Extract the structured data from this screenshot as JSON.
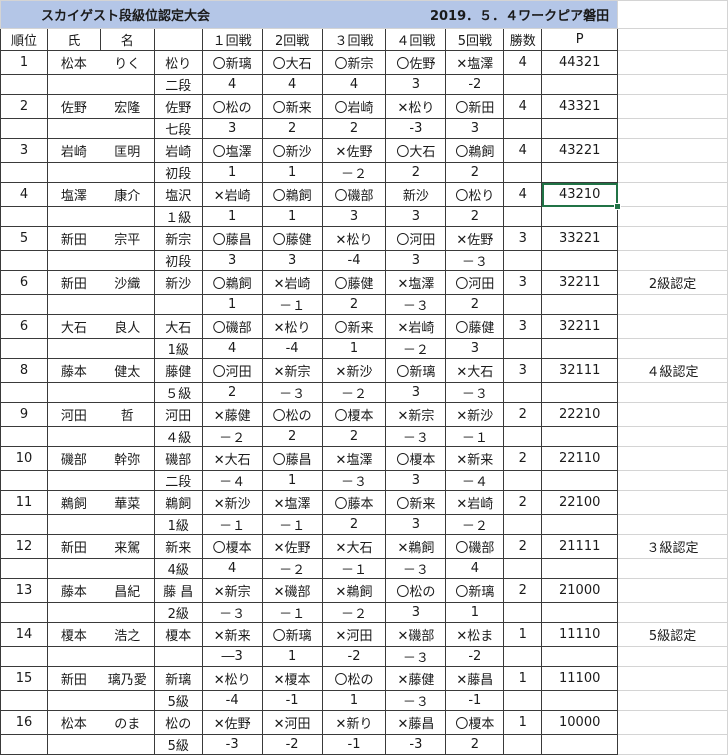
{
  "title": {
    "event": "スカイゲスト段級位認定大会",
    "date_venue": "2019．５．４ワークピア磐田"
  },
  "headers": [
    "順位",
    "氏",
    "名",
    "",
    "１回戦",
    "2回戦",
    "３回戦",
    "４回戦",
    "5回戦",
    "勝数",
    "P"
  ],
  "players": [
    {
      "rank": "1",
      "sur": "松本",
      "given": "りく",
      "short": "松り",
      "grade": "二段",
      "results": [
        "〇新璃",
        "〇大石",
        "〇新宗",
        "〇佐野",
        "✕塩澤"
      ],
      "diffs": [
        "4",
        "4",
        "4",
        "3",
        "-2"
      ],
      "wins": "4",
      "points": "44321",
      "note": ""
    },
    {
      "rank": "2",
      "sur": "佐野",
      "given": "宏隆",
      "short": "佐野",
      "grade": "七段",
      "results": [
        "〇松の",
        "〇新来",
        "〇岩崎",
        "✕松り",
        "〇新田"
      ],
      "diffs": [
        "3",
        "2",
        "2",
        "-3",
        "3"
      ],
      "wins": "4",
      "points": "43321",
      "note": ""
    },
    {
      "rank": "3",
      "sur": "岩崎",
      "given": "匡明",
      "short": "岩崎",
      "grade": "初段",
      "results": [
        "〇塩澤",
        "〇新沙",
        "✕佐野",
        "〇大石",
        "〇鵜飼"
      ],
      "diffs": [
        "1",
        "1",
        "－２",
        "2",
        "2"
      ],
      "wins": "4",
      "points": "43221",
      "note": ""
    },
    {
      "rank": "4",
      "sur": "塩澤",
      "given": "康介",
      "short": "塩沢",
      "grade": "１級",
      "results": [
        "✕岩崎",
        "〇鵜飼",
        "〇磯部",
        "新沙",
        "〇松り"
      ],
      "diffs": [
        "1",
        "1",
        "3",
        "3",
        "2"
      ],
      "wins": "4",
      "points": "43210",
      "note": ""
    },
    {
      "rank": "5",
      "sur": "新田",
      "given": "宗平",
      "short": "新宗",
      "grade": "初段",
      "results": [
        "〇藤昌",
        "〇藤健",
        "✕松り",
        "〇河田",
        "✕佐野"
      ],
      "diffs": [
        "3",
        "3",
        "-4",
        "3",
        "－３"
      ],
      "wins": "3",
      "points": "33221",
      "note": ""
    },
    {
      "rank": "6",
      "sur": "新田",
      "given": "沙織",
      "short": "新沙",
      "grade": "",
      "results": [
        "〇鵜飼",
        "✕岩崎",
        "〇藤健",
        "✕塩澤",
        "〇河田"
      ],
      "diffs": [
        "1",
        "－１",
        "2",
        "－３",
        "2"
      ],
      "wins": "3",
      "points": "32211",
      "note": "2級認定"
    },
    {
      "rank": "6",
      "sur": "大石",
      "given": "良人",
      "short": "大石",
      "grade": "1級",
      "results": [
        "〇磯部",
        "✕松り",
        "〇新来",
        "✕岩崎",
        "〇藤健"
      ],
      "diffs": [
        "4",
        "-4",
        "1",
        "－２",
        "3"
      ],
      "wins": "3",
      "points": "32211",
      "note": ""
    },
    {
      "rank": "8",
      "sur": "藤本",
      "given": "健太",
      "short": "藤健",
      "grade": "５級",
      "results": [
        "〇河田",
        "✕新宗",
        "✕新沙",
        "〇新璃",
        "✕大石"
      ],
      "diffs": [
        "2",
        "－３",
        "－２",
        "3",
        "－３"
      ],
      "wins": "3",
      "points": "32111",
      "note": "４級認定"
    },
    {
      "rank": "9",
      "sur": "河田",
      "given": "哲",
      "short": "河田",
      "grade": "４級",
      "results": [
        "✕藤健",
        "〇松の",
        "〇榎本",
        "✕新宗",
        "✕新沙"
      ],
      "diffs": [
        "－２",
        "2",
        "2",
        "－３",
        "－１"
      ],
      "wins": "2",
      "points": "22210",
      "note": ""
    },
    {
      "rank": "10",
      "sur": "磯部",
      "given": "幹弥",
      "short": "磯部",
      "grade": "二段",
      "results": [
        "✕大石",
        "〇藤昌",
        "✕塩澤",
        "〇榎本",
        "✕新来"
      ],
      "diffs": [
        "－４",
        "1",
        "－３",
        "3",
        "－４"
      ],
      "wins": "2",
      "points": "22110",
      "note": ""
    },
    {
      "rank": "11",
      "sur": "鵜飼",
      "given": "華菜",
      "short": "鵜飼",
      "grade": "1級",
      "results": [
        "✕新沙",
        "✕塩澤",
        "〇藤本",
        "〇新来",
        "✕岩崎"
      ],
      "diffs": [
        "－１",
        "－１",
        "2",
        "3",
        "－２"
      ],
      "wins": "2",
      "points": "22100",
      "note": ""
    },
    {
      "rank": "12",
      "sur": "新田",
      "given": "来駕",
      "short": "新来",
      "grade": "4級",
      "results": [
        "〇榎本",
        "✕佐野",
        "✕大石",
        "✕鵜飼",
        "〇磯部"
      ],
      "diffs": [
        "4",
        "－２",
        "－１",
        "－３",
        "4"
      ],
      "wins": "2",
      "points": "21111",
      "note": "３級認定"
    },
    {
      "rank": "13",
      "sur": "藤本",
      "given": "昌紀",
      "short": "藤 昌",
      "grade": "2級",
      "results": [
        "✕新宗",
        "✕磯部",
        "✕鵜飼",
        "〇松の",
        "〇新璃"
      ],
      "diffs": [
        "－３",
        "－１",
        "－２",
        "3",
        "1"
      ],
      "wins": "2",
      "points": "21000",
      "note": ""
    },
    {
      "rank": "14",
      "sur": "榎本",
      "given": "浩之",
      "short": "榎本",
      "grade": "",
      "results": [
        "✕新来",
        "〇新璃",
        "✕河田",
        "✕磯部",
        "✕松ま"
      ],
      "diffs": [
        "―3",
        "1",
        "-2",
        "－３",
        "-2"
      ],
      "wins": "1",
      "points": "11110",
      "note": "5級認定"
    },
    {
      "rank": "15",
      "sur": "新田",
      "given": "璃乃愛",
      "short": "新璃",
      "grade": "5級",
      "results": [
        "✕松り",
        "✕榎本",
        "〇松の",
        "✕藤健",
        "✕藤昌"
      ],
      "diffs": [
        "-4",
        "-1",
        "1",
        "－３",
        "-1"
      ],
      "wins": "1",
      "points": "11100",
      "note": ""
    },
    {
      "rank": "16",
      "sur": "松本",
      "given": "のま",
      "short": "松の",
      "grade": "5級",
      "results": [
        "✕佐野",
        "✕河田",
        "✕新り",
        "✕藤昌",
        "〇榎本"
      ],
      "diffs": [
        "-3",
        "-2",
        "-1",
        "-3",
        "2"
      ],
      "wins": "1",
      "points": "10000",
      "note": ""
    }
  ]
}
